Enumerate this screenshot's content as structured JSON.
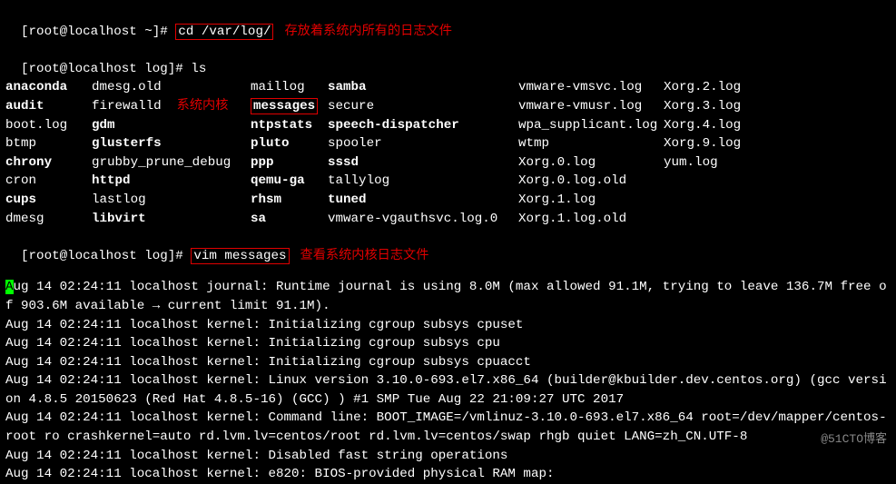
{
  "prompts": {
    "home": "[root@localhost ~]# ",
    "log": "[root@localhost log]# "
  },
  "commands": {
    "cd": "cd /var/log/",
    "ls": "ls",
    "vim": "vim messages"
  },
  "annotations": {
    "cd": "存放着系统内所有的日志文件",
    "kernel": "系统内核",
    "vim": "查看系统内核日志文件"
  },
  "ls_rows": [
    [
      "anaconda",
      "dmesg.old",
      "maillog",
      "samba",
      "vmware-vmsvc.log",
      "Xorg.2.log"
    ],
    [
      "audit",
      "firewalld",
      "messages",
      "secure",
      "vmware-vmusr.log",
      "Xorg.3.log"
    ],
    [
      "boot.log",
      "gdm",
      "ntpstats",
      "speech-dispatcher",
      "wpa_supplicant.log",
      "Xorg.4.log"
    ],
    [
      "btmp",
      "glusterfs",
      "pluto",
      "spooler",
      "wtmp",
      "Xorg.9.log"
    ],
    [
      "chrony",
      "grubby_prune_debug",
      "ppp",
      "sssd",
      "Xorg.0.log",
      "yum.log"
    ],
    [
      "cron",
      "httpd",
      "qemu-ga",
      "tallylog",
      "Xorg.0.log.old",
      ""
    ],
    [
      "cups",
      "lastlog",
      "rhsm",
      "tuned",
      "Xorg.1.log",
      ""
    ],
    [
      "dmesg",
      "libvirt",
      "sa",
      "vmware-vgauthsvc.log.0",
      "Xorg.1.log.old",
      ""
    ]
  ],
  "bold_cells": [
    "anaconda",
    "audit",
    "chrony",
    "cups",
    "gdm",
    "glusterfs",
    "httpd",
    "libvirt",
    "ntpstats",
    "pluto",
    "ppp",
    "qemu-ga",
    "rhsm",
    "sa",
    "samba",
    "speech-dispatcher",
    "sssd",
    "tuned"
  ],
  "boxed_cell": "messages",
  "log_lines": [
    "ug 14 02:24:11 localhost journal: Runtime journal is using 8.0M (max allowed 91.1M, trying to leave 136.7M free of 903.6M available → current limit 91.1M).",
    "Aug 14 02:24:11 localhost kernel: Initializing cgroup subsys cpuset",
    "Aug 14 02:24:11 localhost kernel: Initializing cgroup subsys cpu",
    "Aug 14 02:24:11 localhost kernel: Initializing cgroup subsys cpuacct",
    "Aug 14 02:24:11 localhost kernel: Linux version 3.10.0-693.el7.x86_64 (builder@kbuilder.dev.centos.org) (gcc version 4.8.5 20150623 (Red Hat 4.8.5-16) (GCC) ) #1 SMP Tue Aug 22 21:09:27 UTC 2017",
    "Aug 14 02:24:11 localhost kernel: Command line: BOOT_IMAGE=/vmlinuz-3.10.0-693.el7.x86_64 root=/dev/mapper/centos-root ro crashkernel=auto rd.lvm.lv=centos/root rd.lvm.lv=centos/swap rhgb quiet LANG=zh_CN.UTF-8",
    "Aug 14 02:24:11 localhost kernel: Disabled fast string operations",
    "Aug 14 02:24:11 localhost kernel: e820: BIOS-provided physical RAM map:"
  ],
  "cursor_char": "A",
  "watermark": "@51CTO博客"
}
